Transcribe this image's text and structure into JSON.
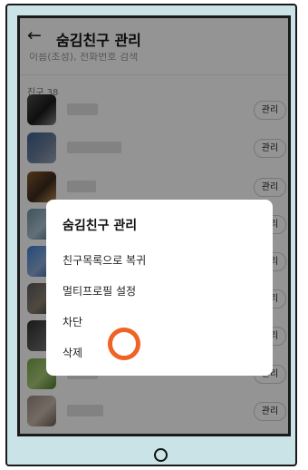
{
  "header": {
    "back_icon": "arrow-left-icon",
    "title": "숨김친구 관리"
  },
  "search": {
    "placeholder": "이름(초성), 전화번호 검색"
  },
  "friends": {
    "count_label": "친구 38",
    "manage_label": "관리"
  },
  "rows": [
    {
      "avatar_colors": [
        "#4a4a4a",
        "#1b1b1b",
        "#8a8a8a"
      ]
    },
    {
      "avatar_colors": [
        "#3e5f8f",
        "#6b7e99",
        "#9aa6b8"
      ]
    },
    {
      "avatar_colors": [
        "#8a5a2b",
        "#3a2a1e",
        "#c08a50"
      ]
    },
    {
      "avatar_colors": [
        "#6f8fa0",
        "#a9c2d0",
        "#486577"
      ]
    },
    {
      "avatar_colors": [
        "#3f7fd0",
        "#8aa9d6",
        "#2d5da0"
      ]
    },
    {
      "avatar_colors": [
        "#5a5a5a",
        "#8b7e70",
        "#3a3a3a"
      ]
    },
    {
      "avatar_colors": [
        "#2e2e2e",
        "#5a5a5a",
        "#7a7a7a"
      ]
    },
    {
      "avatar_colors": [
        "#79a544",
        "#a8c97a",
        "#4f7a2a"
      ]
    },
    {
      "avatar_colors": [
        "#9a8a80",
        "#c7b8ad",
        "#6d5e54"
      ]
    }
  ],
  "dialog": {
    "title": "숨김친구 관리",
    "items": [
      "친구목록으로 복귀",
      "멀티프로필 설정",
      "차단",
      "삭제"
    ]
  },
  "colors": {
    "marker": "#f06326",
    "device_frame": "#c9e3e6"
  }
}
